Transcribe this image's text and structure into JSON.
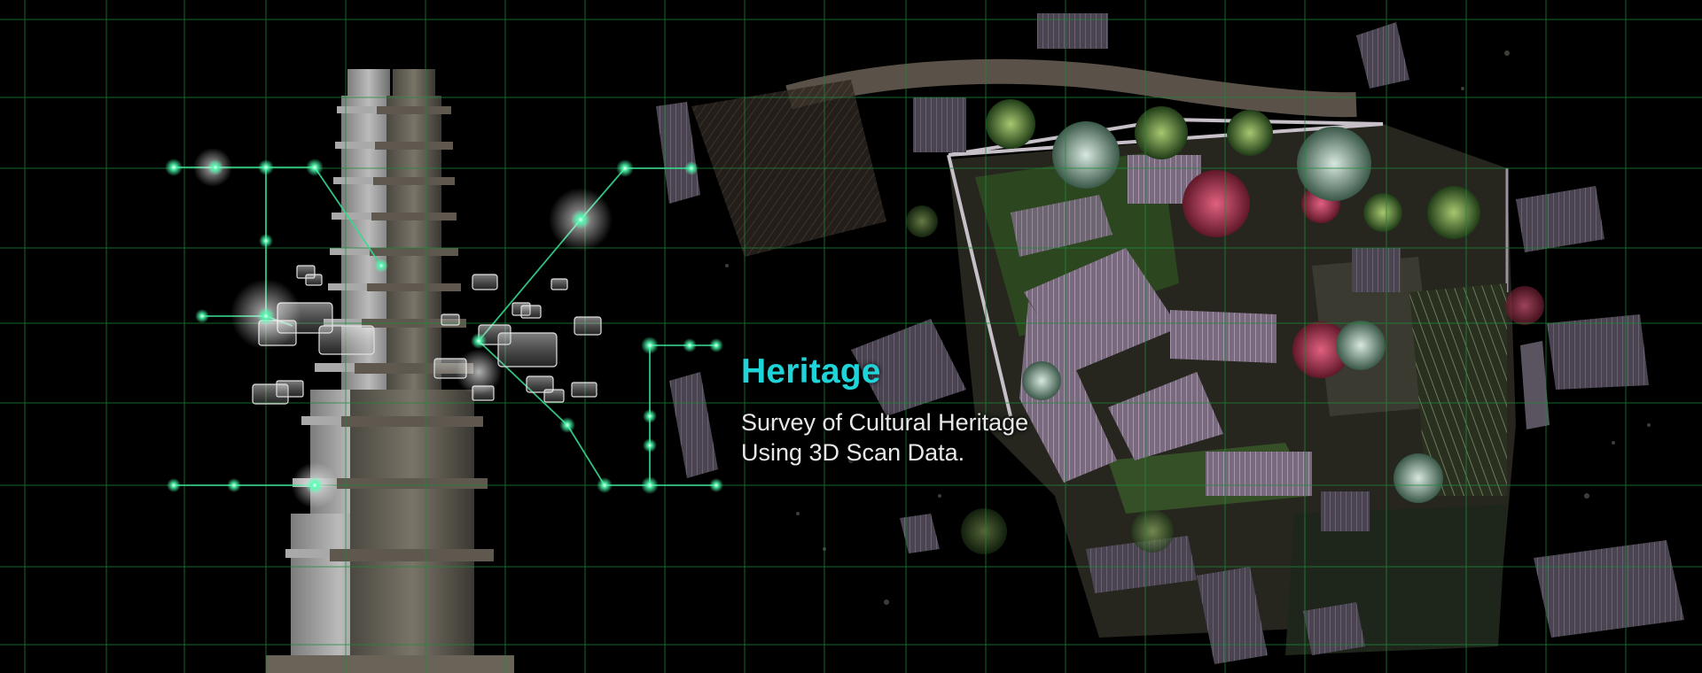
{
  "hero": {
    "title": "Heritage",
    "description_line1": "Survey of Cultural Heritage",
    "description_line2": "Using 3D Scan Data."
  },
  "colors": {
    "background": "#000000",
    "grid_line": "#1d8a3a",
    "accent_title": "#1fd4d9",
    "node_glow": "#4dffb0",
    "description_text": "#e8e8e8"
  },
  "imagery": {
    "left": "3d-scanned-stone-pagoda",
    "right": "aerial-point-cloud-traditional-village"
  }
}
